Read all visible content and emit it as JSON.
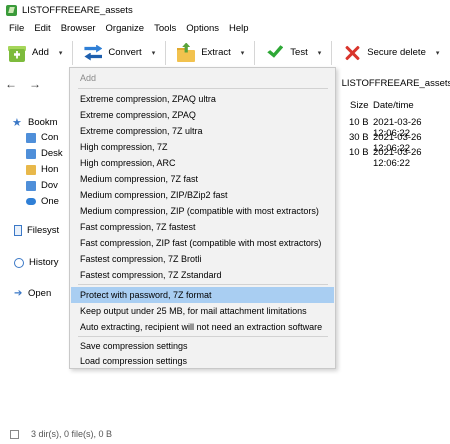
{
  "window": {
    "title": "LISTOFFREEARE_assets"
  },
  "menubar": [
    "File",
    "Edit",
    "Browser",
    "Organize",
    "Tools",
    "Options",
    "Help"
  ],
  "toolbar": {
    "add": "Add",
    "convert": "Convert",
    "extract": "Extract",
    "test": "Test",
    "secure_delete": "Secure delete",
    "dropdown_glyph": "▾"
  },
  "nav": {
    "back": "←",
    "forward": "→",
    "breadcrumb_sep": ">",
    "breadcrumb": "LISTOFFREEARE_assets"
  },
  "tree": {
    "bookmarks": "Bookm",
    "items": [
      "Con",
      "Desk",
      "Hon",
      "Dov",
      "One"
    ],
    "filesystem": "Filesyst",
    "history": "History",
    "open": "Open"
  },
  "listing": {
    "col_size": "Size",
    "col_date": "Date/time",
    "rows": [
      {
        "size": "10 B",
        "date": "2021-03-26 12:06:22"
      },
      {
        "size": "30 B",
        "date": "2021-03-26 12:06:22"
      },
      {
        "size": "10 B",
        "date": "2021-03-26 12:06:22"
      }
    ]
  },
  "status": {
    "text": "3 dir(s), 0 file(s), 0 B"
  },
  "dropdown": {
    "header": "Add",
    "group1": [
      "Extreme compression, ZPAQ ultra",
      "Extreme compression, ZPAQ",
      "Extreme compression, 7Z ultra",
      "High compression, 7Z",
      "High compression, ARC",
      "Medium compression, 7Z fast",
      "Medium compression, ZIP/BZip2 fast",
      "Medium compression, ZIP (compatible with most extractors)",
      "Fast compression, 7Z fastest",
      "Fast compression, ZIP fast (compatible with most extractors)",
      "Fastest compression, 7Z Brotli",
      "Fastest compression, 7Z Zstandard"
    ],
    "group2": [
      "Protect with password, 7Z format",
      "Keep output under 25 MB, for mail attachment limitations",
      "Auto extracting, recipient will not need an extraction software"
    ],
    "group3": [
      "Save compression settings",
      "Load compression settings"
    ]
  },
  "colors": {
    "menu_highlight": "#a9cef2",
    "menu_bg": "#f2f2f2",
    "accent": "#3b78c6"
  }
}
